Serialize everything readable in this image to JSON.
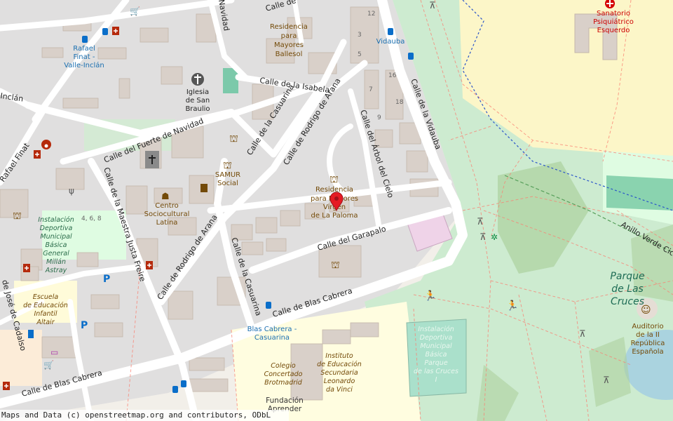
{
  "streets": {
    "isabela": "Calle de la Isabela",
    "fuerte_navidad": "Calle del Fuerte de Navidad",
    "casuarina_n": "Calle de la Casuarina",
    "casuarina_s": "Calle de la Casuarina",
    "rodrigo_arana_n": "Calle de Rodrigo de Arana",
    "rodrigo_arana_s": "Calle de Rodrigo de Arana",
    "arbol_cielo": "Calle del Árbol del Cielo",
    "vidauba": "Calle de la Vidauba",
    "garapalo": "Calle del Garapalo",
    "blas_cabrera_e": "Calle de Blas Cabrera",
    "blas_cabrera_w": "Calle de Blas Cabrera",
    "maestra_justa": "Calle de la Maestra Justa Freire",
    "rafael_finat": "Rafael Finat",
    "jose_cadalso": "de José de Cadalso",
    "navidad_top": "Navidad",
    "calle_top": "Calle de",
    "inclan": "Inclán",
    "anillo_verde": "Anillo Verde Cicl"
  },
  "places": {
    "residencia_ballesol": [
      "Residencia",
      "para",
      "Mayores",
      "Ballesol"
    ],
    "iglesia": [
      "Iglesia",
      "de San",
      "Braulio"
    ],
    "samur": [
      "SAMUR",
      "Social"
    ],
    "centro_socio": [
      "Centro",
      "Sociocultural",
      "Latina"
    ],
    "residencia_paloma": [
      "Residencia",
      "para Mayores",
      "Virgen",
      "de La Paloma"
    ],
    "sanatorio": [
      "Sanatorio",
      "Psiquiátrico",
      "Esquerdo"
    ],
    "instalacion_west": [
      "Instalación",
      "Deportiva",
      "Municipal",
      "Básica",
      "General",
      "Millán",
      "Astray"
    ],
    "escuela": [
      "Escuela",
      "de Educación",
      "Infantil",
      "Altair"
    ],
    "colegio": [
      "Colegio",
      "Concertado",
      "Brotmadrid"
    ],
    "instituto": [
      "Instituto",
      "de Educación",
      "Secundaria",
      "Leonardo",
      "da Vinci"
    ],
    "instalacion_park": [
      "Instalación",
      "Deportiva",
      "Municipal",
      "Básica",
      "Parque",
      "de las Cruces",
      "I"
    ],
    "auditorio": [
      "Auditorio",
      "de la II",
      "República",
      "Española"
    ],
    "fundacion": [
      "Fundación",
      "Aprender"
    ],
    "parque": [
      "Parque",
      "de Las",
      "Cruces"
    ]
  },
  "transit": {
    "rafael_finat": [
      "Rafael",
      "Finat -",
      "Valle-Inclán"
    ],
    "vidauba": "Vidauba",
    "blas_cabrera": [
      "Blas Cabrera -",
      "Casuarina"
    ]
  },
  "house_numbers": [
    "12",
    "3",
    "5",
    "16",
    "18",
    "7",
    "9",
    "4, 6, 8"
  ],
  "marker": {
    "color": "#e51b23"
  },
  "colors": {
    "background": "#f2efe9",
    "road": "#ffffff",
    "building": "#d9d0c9",
    "park": "#cdebd0",
    "hospital_area": "#fcf6c8",
    "pitch": "#aae0cb",
    "sports": "#dffce2",
    "water": "#aad3df"
  },
  "attribution": "Maps and Data (c) openstreetmap.org and contributors, ODbL"
}
